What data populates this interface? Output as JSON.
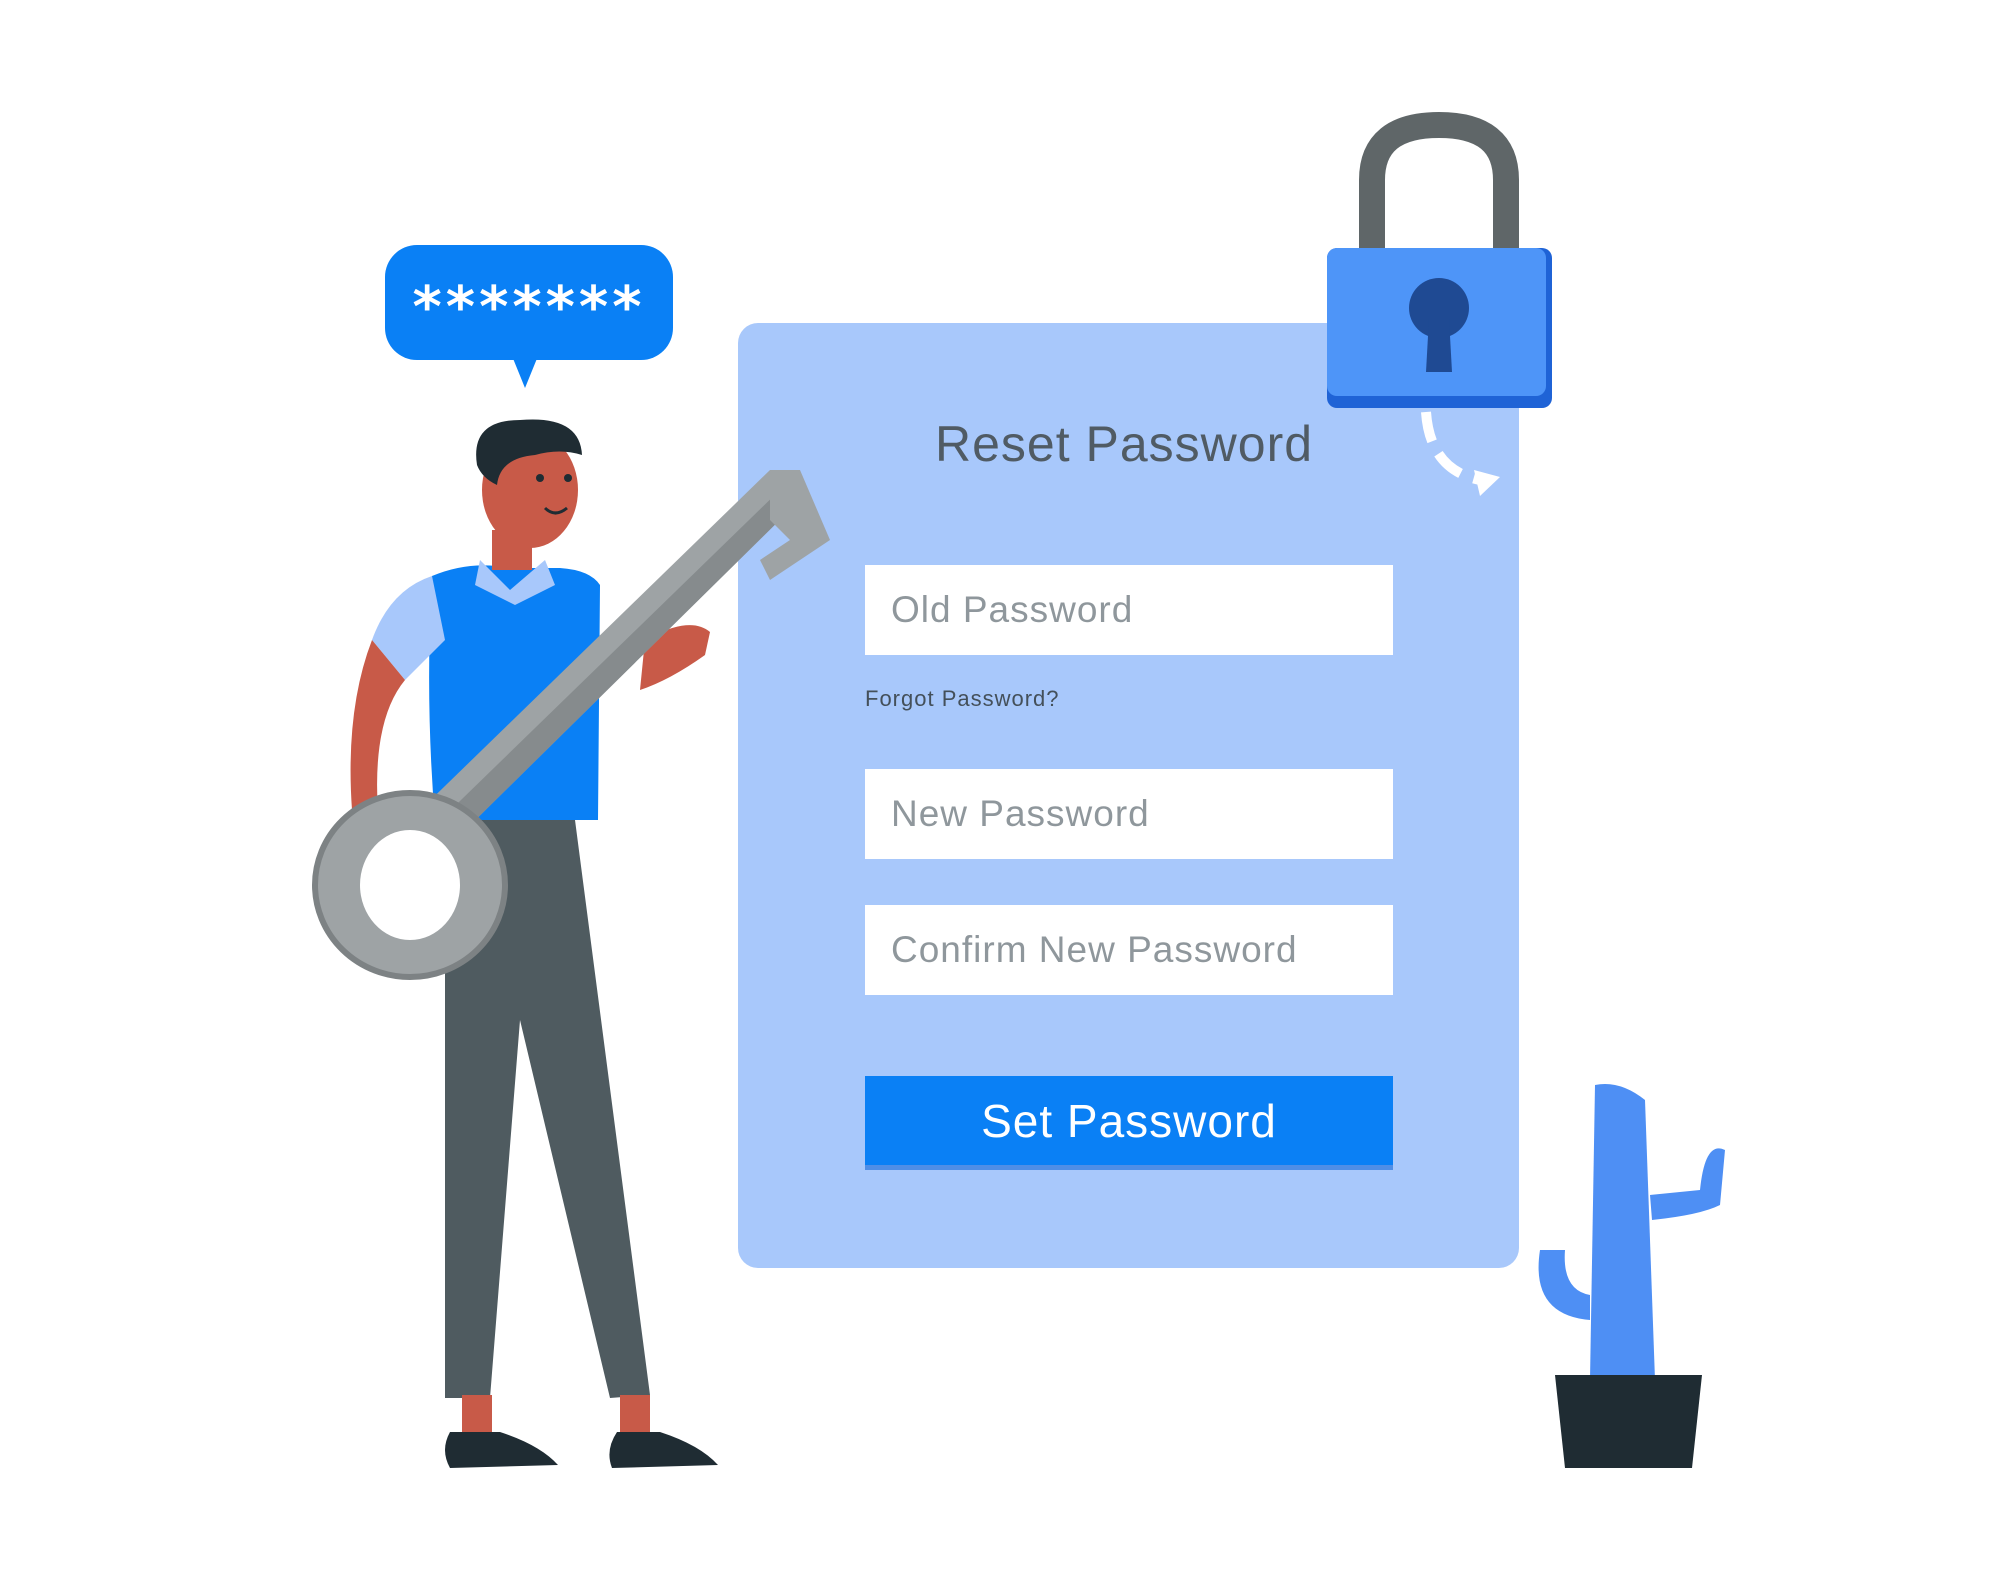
{
  "bubble": {
    "text": "*******"
  },
  "form": {
    "title": "Reset Password",
    "old_password_placeholder": "Old Password",
    "forgot_link": "Forgot Password?",
    "new_password_placeholder": "New Password",
    "confirm_password_placeholder": "Confirm New Password",
    "submit_label": "Set Password"
  },
  "colors": {
    "primary_blue": "#0a80f5",
    "card_blue": "#a8c8fb",
    "title_gray": "#505b64",
    "placeholder_gray": "#8f979c",
    "key_gray": "#9ea3a5",
    "pants_gray": "#4f5b60",
    "skin": "#c85a48",
    "pot_dark": "#1f2c33"
  },
  "icons": [
    "padlock-icon",
    "key-icon",
    "cactus-icon"
  ]
}
